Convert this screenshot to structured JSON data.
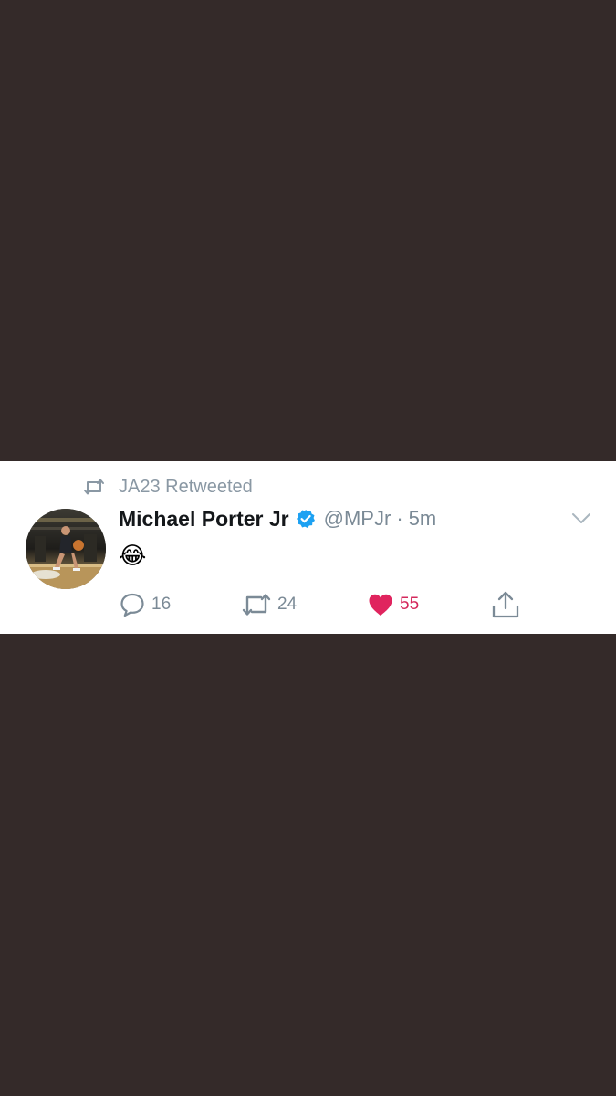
{
  "retweet_banner": {
    "text": "JA23 Retweeted",
    "icon": "retweet-icon"
  },
  "tweet": {
    "display_name": "Michael Porter Jr",
    "verified": true,
    "handle": "@MPJr",
    "separator": "·",
    "time": "5m",
    "text": "😂"
  },
  "actions": {
    "reply_count": "16",
    "retweet_count": "24",
    "like_count": "55",
    "liked": true
  },
  "colors": {
    "background": "#342a29",
    "card": "#ffffff",
    "muted": "#7b8a96",
    "verified_blue": "#1da1f2",
    "like_red": "#e0245e"
  }
}
